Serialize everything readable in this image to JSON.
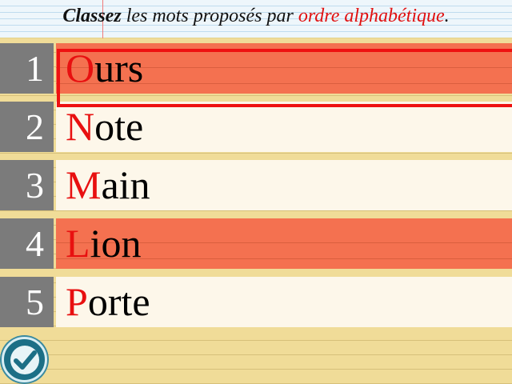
{
  "instruction": {
    "part1": "Classez",
    "part2": " les mots proposés par ",
    "part3": "ordre alphabétique",
    "part4": "."
  },
  "rows": [
    {
      "number": "1",
      "first_letter": "O",
      "rest": "urs",
      "highlighted": true,
      "selected": true
    },
    {
      "number": "2",
      "first_letter": "N",
      "rest": "ote",
      "highlighted": false,
      "selected": false
    },
    {
      "number": "3",
      "first_letter": "M",
      "rest": "ain",
      "highlighted": false,
      "selected": false
    },
    {
      "number": "4",
      "first_letter": "L",
      "rest": "ion",
      "highlighted": true,
      "selected": false
    },
    {
      "number": "5",
      "first_letter": "P",
      "rest": "orte",
      "highlighted": false,
      "selected": false
    }
  ],
  "validate_button": {
    "icon": "checkmark-icon"
  },
  "colors": {
    "accent_red": "#e81010",
    "highlight": "#f47150",
    "number_tab": "#7b7b7b",
    "word_bg": "#fdf7ea",
    "button": "#1c6f86"
  }
}
